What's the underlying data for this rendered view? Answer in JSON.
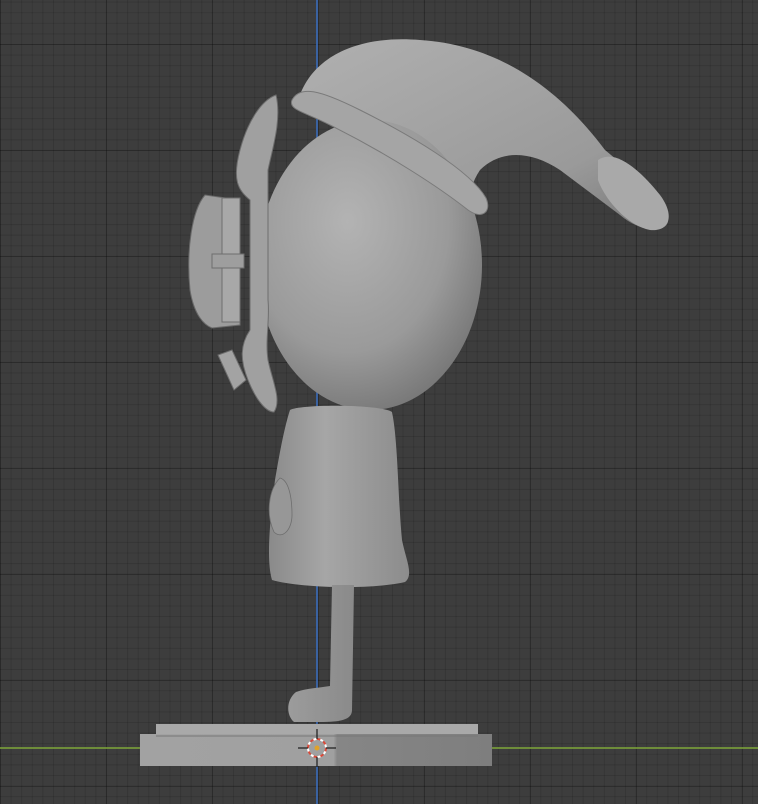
{
  "viewport": {
    "background": "#3d3d3d",
    "grid_line_color": "#2e2e2e",
    "axis_colors": {
      "z_axis": "#3a6fc2",
      "y_axis": "#7fa83a"
    }
  },
  "model": {
    "surface_color": "#9a9a9a",
    "base_color": "#8e8e8e",
    "shadow_color": "#6c6c6c"
  },
  "cursor_3d": {
    "ring_color_a": "#d94a3a",
    "ring_color_b": "#ffffff",
    "center_color": "#e0a22a",
    "icon": "3d-cursor-icon"
  }
}
